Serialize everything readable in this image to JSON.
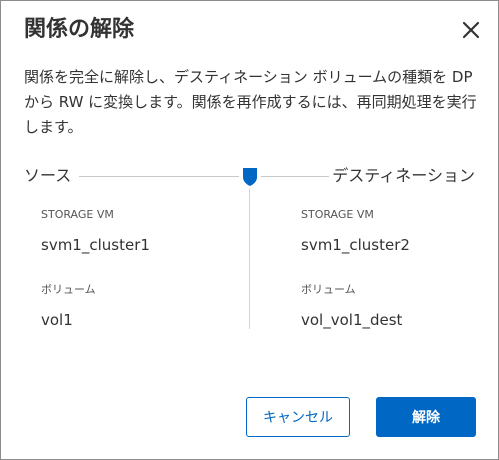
{
  "dialog": {
    "title": "関係の解除",
    "description": "関係を完全に解除し、デスティネーション ボリュームの種類を DP から RW に変換します。関係を再作成するには、再同期処理を実行します。"
  },
  "relationship": {
    "source_label": "ソース",
    "destination_label": "デスティネーション",
    "source": {
      "storage_vm_label": "STORAGE VM",
      "storage_vm": "svm1_cluster1",
      "volume_label": "ボリューム",
      "volume": "vol1"
    },
    "destination": {
      "storage_vm_label": "STORAGE VM",
      "storage_vm": "svm1_cluster2",
      "volume_label": "ボリューム",
      "volume": "vol_vol1_dest"
    }
  },
  "buttons": {
    "cancel_label": "キャンセル",
    "break_label": "解除"
  },
  "icons": {
    "close": "close-icon",
    "shield": "shield-icon"
  },
  "colors": {
    "accent": "#0067c5",
    "text": "#333333",
    "divider": "#c8c8c8"
  }
}
